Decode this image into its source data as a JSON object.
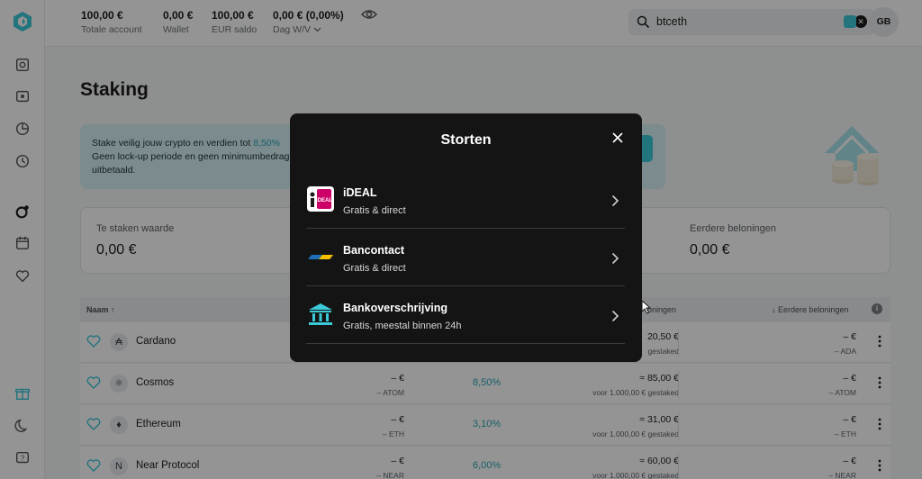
{
  "header": {
    "stats": [
      {
        "value": "100,00 €",
        "label": "Totale account"
      },
      {
        "value": "0,00 €",
        "label": "Wallet"
      },
      {
        "value": "100,00 €",
        "label": "EUR saldo"
      },
      {
        "value": "0,00 € (0,00%)",
        "label": "Dag W/V"
      }
    ],
    "search": {
      "value": "btceth"
    },
    "avatar": "GB"
  },
  "sidebar": {
    "icons": [
      "dashboard-icon",
      "wallet-icon",
      "portfolio-icon",
      "history-icon",
      "staking-icon",
      "calendar-icon",
      "favorites-icon",
      "gift-icon",
      "dark-mode-icon",
      "help-icon"
    ]
  },
  "main": {
    "title": "Staking",
    "banner": {
      "line1": "Stake veilig jouw crypto en verdien tot",
      "rate": "8,50%",
      "line2": "Geen lock-up periode en geen minimumbedrag",
      "line3": "uitbetaald."
    },
    "summary": {
      "left_label": "Te staken waarde",
      "left_value": "0,00 €",
      "right_label": "Eerdere beloningen",
      "right_value": "0,00 €"
    },
    "table": {
      "headers": {
        "name": "Naam ↑",
        "rewards": "loningen",
        "past": "↓ Eerdere beloningen"
      },
      "rows": [
        {
          "name": "Cardano",
          "icon": "₳",
          "c1v": "",
          "c1s": "",
          "apy": "",
          "rv": "20,50 €",
          "rs": "gestaked",
          "ev": "– €",
          "es": "– ADA"
        },
        {
          "name": "Cosmos",
          "icon": "⚛",
          "c1v": "– €",
          "c1s": "– ATOM",
          "apy": "8,50%",
          "rv": "≈ 85,00 €",
          "rs": "voor 1.000,00 € gestaked",
          "ev": "– €",
          "es": "– ATOM"
        },
        {
          "name": "Ethereum",
          "icon": "♦",
          "c1v": "– €",
          "c1s": "– ETH",
          "apy": "3,10%",
          "rv": "≈ 31,00 €",
          "rs": "voor 1.000,00 € gestaked",
          "ev": "– €",
          "es": "– ETH"
        },
        {
          "name": "Near Protocol",
          "icon": "N",
          "c1v": "– €",
          "c1s": "– NEAR",
          "apy": "6,00%",
          "rv": "≈ 60,00 €",
          "rs": "voor 1.000,00 € gestaked",
          "ev": "– €",
          "es": "– NEAR"
        }
      ]
    }
  },
  "modal": {
    "title": "Storten",
    "options": [
      {
        "name": "iDEAL",
        "sub": "Gratis & direct",
        "icon": "ideal-icon"
      },
      {
        "name": "Bancontact",
        "sub": "Gratis & direct",
        "icon": "bancontact-icon"
      },
      {
        "name": "Bankoverschrijving",
        "sub": "Gratis, meestal binnen 24h",
        "icon": "bank-icon"
      }
    ],
    "ideal_logo_text": "iDEAL"
  },
  "colors": {
    "accent": "#3cc9d8",
    "modal_bg": "#141414",
    "ideal_pink": "#cc0066"
  }
}
